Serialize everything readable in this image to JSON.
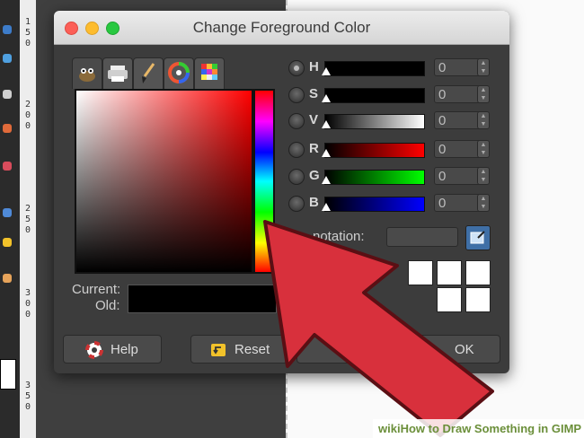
{
  "dialog": {
    "title": "Change Foreground Color",
    "tabs": [
      "gimp-wilber-icon",
      "scales-printer-icon",
      "watercolor-brush-icon",
      "color-wheel-icon",
      "palette-icon"
    ],
    "current_label": "Current:",
    "old_label": "Old:",
    "channels": [
      {
        "letter": "H",
        "value": "0",
        "selected": true
      },
      {
        "letter": "S",
        "value": "0",
        "selected": false
      },
      {
        "letter": "V",
        "value": "0",
        "selected": false
      },
      {
        "letter": "R",
        "value": "0",
        "selected": false
      },
      {
        "letter": "G",
        "value": "0",
        "selected": false
      },
      {
        "letter": "B",
        "value": "0",
        "selected": false
      }
    ],
    "hex_label": "notation:",
    "buttons": {
      "help": "Help",
      "reset": "Reset",
      "ok": "OK"
    },
    "colors": {
      "current": "#000000",
      "old": "#000000"
    }
  },
  "ruler": {
    "left_numbers": [
      "1",
      "5",
      "0",
      "2",
      "0",
      "0",
      "2",
      "5",
      "0",
      "3",
      "0",
      "0",
      "3",
      "5",
      "0"
    ]
  },
  "watermark": {
    "brand": "wiki",
    "text": "How to Draw Something in GIMP"
  }
}
